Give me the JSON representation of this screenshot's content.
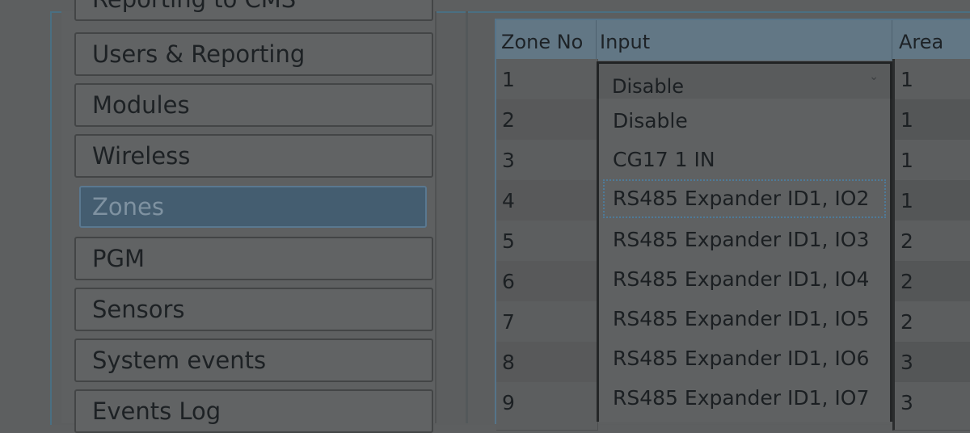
{
  "nav": {
    "items": [
      {
        "label": "Reporting to CMS",
        "active": false
      },
      {
        "label": "Users & Reporting",
        "active": false
      },
      {
        "label": "Modules",
        "active": false
      },
      {
        "label": "Wireless",
        "active": false
      },
      {
        "label": "Zones",
        "active": true
      },
      {
        "label": "PGM",
        "active": false
      },
      {
        "label": "Sensors",
        "active": false
      },
      {
        "label": "System events",
        "active": false
      },
      {
        "label": "Events Log",
        "active": false
      }
    ]
  },
  "grid": {
    "columns": [
      "Zone No",
      "Input",
      "Area"
    ],
    "rows": [
      {
        "zone": "1",
        "area": "1"
      },
      {
        "zone": "2",
        "area": "1"
      },
      {
        "zone": "3",
        "area": "1"
      },
      {
        "zone": "4",
        "area": "1"
      },
      {
        "zone": "5",
        "area": "2"
      },
      {
        "zone": "6",
        "area": "2"
      },
      {
        "zone": "7",
        "area": "2"
      },
      {
        "zone": "8",
        "area": "3"
      },
      {
        "zone": "9",
        "area": "3"
      }
    ]
  },
  "input_dropdown": {
    "value": "Disable",
    "options": [
      "Disable",
      "CG17 1 IN",
      "RS485 Expander ID1, IO2",
      "RS485 Expander ID1, IO3",
      "RS485 Expander ID1, IO4",
      "RS485 Expander ID1, IO5",
      "RS485 Expander ID1, IO6",
      "RS485 Expander ID1, IO7"
    ],
    "highlighted_option": "RS485 Expander ID1, IO2",
    "chevron_icon": "chevron-down-icon"
  }
}
